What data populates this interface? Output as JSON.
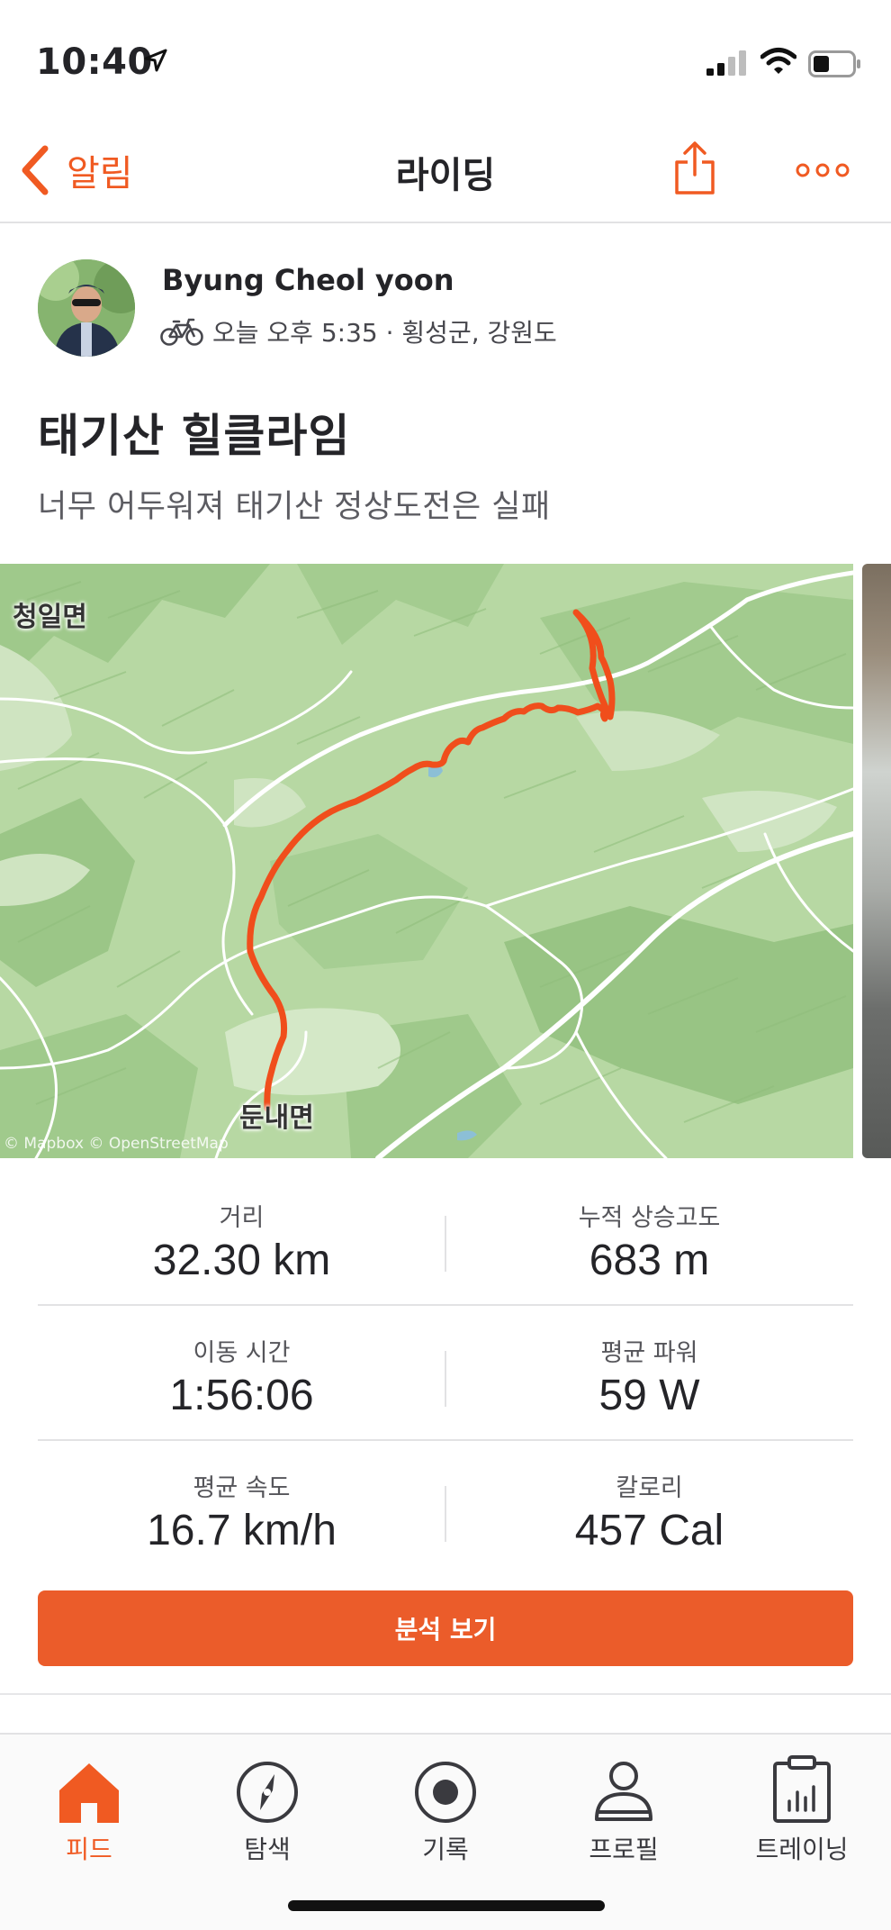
{
  "status_bar": {
    "time": "10:40"
  },
  "nav": {
    "back_label": "알림",
    "title": "라이딩"
  },
  "post": {
    "athlete_name": "Byung Cheol yoon",
    "meta": "오늘 오후 5:35 · 횡성군, 강원도",
    "title": "태기산 힐클라임",
    "description": "너무 어두워져  태기산 정상도전은 실패"
  },
  "map": {
    "label_top_left": "청일면",
    "label_bottom": "둔내면",
    "attribution": "© Mapbox © OpenStreetMap"
  },
  "stats": [
    {
      "left": {
        "label": "거리",
        "value": "32.30 km"
      },
      "right": {
        "label": "누적 상승고도",
        "value": "683 m"
      }
    },
    {
      "left": {
        "label": "이동 시간",
        "value": "1:56:06"
      },
      "right": {
        "label": "평균 파워",
        "value": "59 W"
      }
    },
    {
      "left": {
        "label": "평균 속도",
        "value": "16.7 km/h"
      },
      "right": {
        "label": "칼로리",
        "value": "457 Cal"
      }
    }
  ],
  "analyze_button": "분석 보기",
  "tabs": [
    {
      "label": "피드",
      "icon": "home-icon",
      "active": true
    },
    {
      "label": "탐색",
      "icon": "compass-icon",
      "active": false
    },
    {
      "label": "기록",
      "icon": "record-icon",
      "active": false
    },
    {
      "label": "프로필",
      "icon": "profile-icon",
      "active": false
    },
    {
      "label": "트레이닝",
      "icon": "training-icon",
      "active": false
    }
  ],
  "colors": {
    "accent": "#F05A22",
    "route": "#F4511E",
    "map_green": "#B9D9A6"
  }
}
